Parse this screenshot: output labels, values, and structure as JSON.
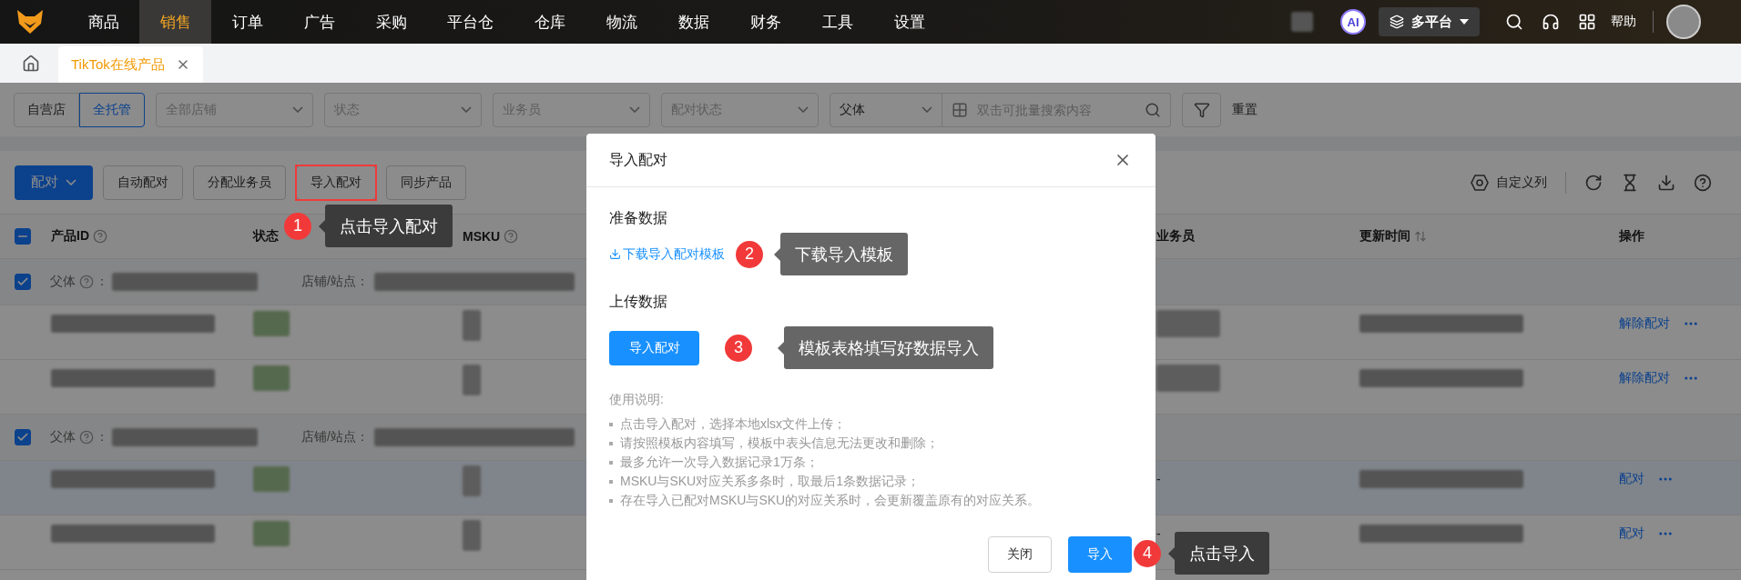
{
  "top_nav": {
    "menu": [
      {
        "label": "商品",
        "selected": false
      },
      {
        "label": "销售",
        "selected": true
      },
      {
        "label": "订单",
        "selected": false
      },
      {
        "label": "广告",
        "selected": false
      },
      {
        "label": "采购",
        "selected": false
      },
      {
        "label": "平台仓",
        "selected": false
      },
      {
        "label": "仓库",
        "selected": false
      },
      {
        "label": "物流",
        "selected": false
      },
      {
        "label": "数据",
        "selected": false
      },
      {
        "label": "财务",
        "selected": false
      },
      {
        "label": "工具",
        "selected": false
      },
      {
        "label": "设置",
        "selected": false
      }
    ],
    "ai_badge": "AI",
    "platform": "多平台",
    "help": "帮助"
  },
  "tabs": [
    {
      "label": "TikTok在线产品",
      "selected": true
    }
  ],
  "filters": {
    "store_type": [
      {
        "label": "自营店",
        "selected": false
      },
      {
        "label": "全托管",
        "selected": true
      }
    ],
    "selects": [
      {
        "placeholder": "全部店铺"
      },
      {
        "placeholder": "状态"
      },
      {
        "placeholder": "业务员"
      },
      {
        "placeholder": "配对状态"
      }
    ],
    "search_scope": "父体",
    "search": {
      "placeholder": "双击可批量搜索内容"
    },
    "reset": "重置"
  },
  "toolbar": {
    "primary": "配对",
    "buttons": [
      {
        "label": "自动配对",
        "highlighted": false
      },
      {
        "label": "分配业务员",
        "highlighted": false
      },
      {
        "label": "导入配对",
        "highlighted": true
      },
      {
        "label": "同步产品",
        "highlighted": false
      }
    ],
    "custom_columns": "自定义列"
  },
  "table": {
    "select_all": {
      "indeterminate": true
    },
    "columns": [
      {
        "label": "产品ID",
        "help": true,
        "sortable": false
      },
      {
        "label": "状态",
        "help": false,
        "sortable": false
      },
      {
        "label": "MSKU",
        "help": true,
        "sortable": false
      },
      {
        "label": "业务员",
        "help": false,
        "sortable": false
      },
      {
        "label": "更新时间",
        "help": false,
        "sortable": true
      },
      {
        "label": "操作",
        "help": false,
        "sortable": false
      }
    ],
    "groups": [
      {
        "checked": true,
        "parent_label": "父体",
        "separator": "：",
        "store_label": "店铺/站点：",
        "rows": [
          {
            "highlighted": false,
            "action": "解除配对"
          },
          {
            "highlighted": false,
            "action": "解除配对"
          }
        ]
      },
      {
        "checked": true,
        "parent_label": "父体",
        "separator": "：",
        "store_label": "店铺/站点：",
        "rows": [
          {
            "highlighted": true,
            "salesperson": "-",
            "action": "配对"
          },
          {
            "highlighted": false,
            "salesperson": "-",
            "action": "配对"
          }
        ]
      }
    ]
  },
  "modal": {
    "title": "导入配对",
    "prepare_heading": "准备数据",
    "download_link": "下载导入配对模板",
    "download_callout": {
      "number": "2",
      "text": "下载导入模板"
    },
    "upload_heading": "上传数据",
    "upload_button": "导入配对",
    "upload_callout": {
      "number": "3",
      "text": "模板表格填写好数据导入"
    },
    "instructions_heading": "使用说明:",
    "instructions": [
      "点击导入配对，选择本地xlsx文件上传；",
      "请按照模板内容填写，模板中表头信息无法更改和删除；",
      "最多允许一次导入数据记录1万条；",
      "MSKU与SKU对应关系多条时，取最后1条数据记录；",
      "存在导入已配对MSKU与SKU的对应关系时，会更新覆盖原有的对应关系。"
    ],
    "close_button": "关闭",
    "import_button": "导入"
  },
  "callouts": [
    {
      "number": "1",
      "text": "点击导入配对"
    },
    {
      "number": "4",
      "text": "点击导入"
    }
  ]
}
